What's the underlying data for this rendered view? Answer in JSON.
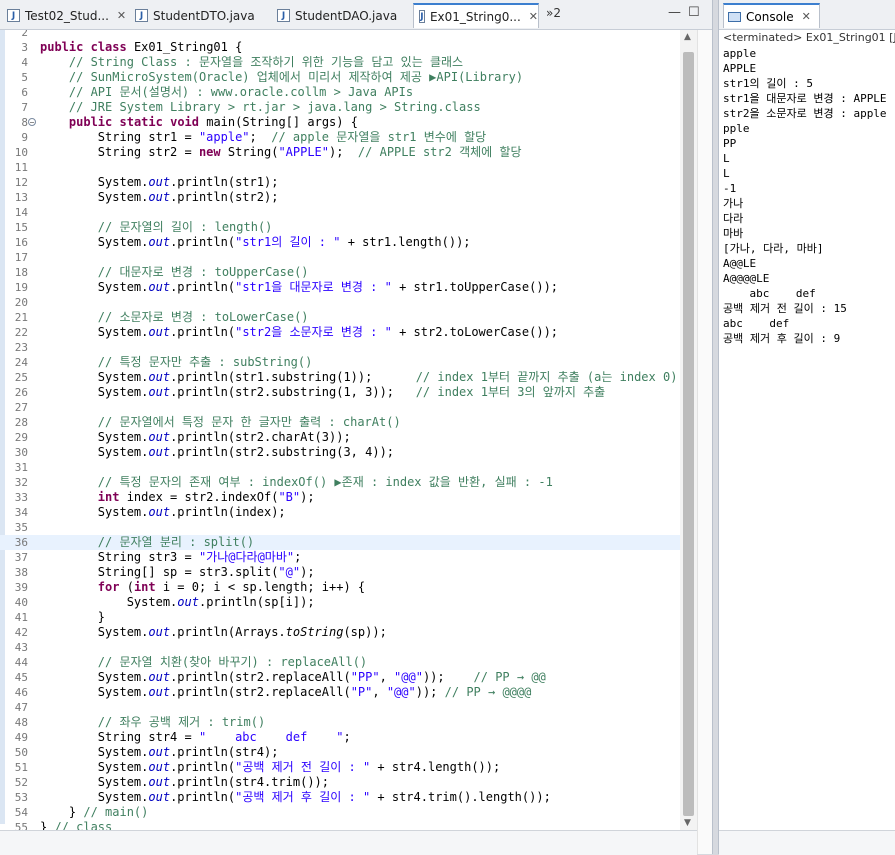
{
  "tabs": [
    {
      "label": "Test02_Stud...",
      "icon": "java-file-icon",
      "active": false
    },
    {
      "label": "StudentDTO.java",
      "icon": "java-file-icon",
      "active": false
    },
    {
      "label": "StudentDAO.java",
      "icon": "java-file-icon",
      "active": false
    },
    {
      "label": "Ex01_String0...",
      "icon": "java-file-icon",
      "active": true
    }
  ],
  "overflow_label": "»2",
  "code": [
    {
      "n": "2",
      "t": ""
    },
    {
      "n": "3",
      "t": "public class Ex01_String01 {"
    },
    {
      "n": "4",
      "t": "    // String Class : 문자열을 조작하기 위한 기능을 담고 있는 클래스"
    },
    {
      "n": "5",
      "t": "    // SunMicroSystem(Oracle) 업체에서 미리서 제작하여 제공 ▶API(Library)"
    },
    {
      "n": "6",
      "t": "    // API 문서(설명서) : www.oracle.collm > Java APIs"
    },
    {
      "n": "7",
      "t": "    // JRE System Library > rt.jar > java.lang > String.class"
    },
    {
      "n": "8",
      "t": "    public static void main(String[] args) {"
    },
    {
      "n": "9",
      "t": "        String str1 = \"apple\";  // apple 문자열을 str1 변수에 할당"
    },
    {
      "n": "10",
      "t": "        String str2 = new String(\"APPLE\");  // APPLE str2 객체에 할당"
    },
    {
      "n": "11",
      "t": ""
    },
    {
      "n": "12",
      "t": "        System.out.println(str1);"
    },
    {
      "n": "13",
      "t": "        System.out.println(str2);"
    },
    {
      "n": "14",
      "t": ""
    },
    {
      "n": "15",
      "t": "        // 문자열의 길이 : length()"
    },
    {
      "n": "16",
      "t": "        System.out.println(\"str1의 길이 : \" + str1.length());"
    },
    {
      "n": "17",
      "t": ""
    },
    {
      "n": "18",
      "t": "        // 대문자로 변경 : toUpperCase()"
    },
    {
      "n": "19",
      "t": "        System.out.println(\"str1을 대문자로 변경 : \" + str1.toUpperCase());"
    },
    {
      "n": "20",
      "t": ""
    },
    {
      "n": "21",
      "t": "        // 소문자로 변경 : toLowerCase()"
    },
    {
      "n": "22",
      "t": "        System.out.println(\"str2을 소문자로 변경 : \" + str2.toLowerCase());"
    },
    {
      "n": "23",
      "t": ""
    },
    {
      "n": "24",
      "t": "        // 특정 문자만 추출 : subString()"
    },
    {
      "n": "25",
      "t": "        System.out.println(str1.substring(1));      // index 1부터 끝까지 추출 (a는 index 0)"
    },
    {
      "n": "26",
      "t": "        System.out.println(str2.substring(1, 3));   // index 1부터 3의 앞까지 추출"
    },
    {
      "n": "27",
      "t": ""
    },
    {
      "n": "28",
      "t": "        // 문자열에서 특정 문자 한 글자만 출력 : charAt()"
    },
    {
      "n": "29",
      "t": "        System.out.println(str2.charAt(3));"
    },
    {
      "n": "30",
      "t": "        System.out.println(str2.substring(3, 4));"
    },
    {
      "n": "31",
      "t": ""
    },
    {
      "n": "32",
      "t": "        // 특정 문자의 존재 여부 : indexOf() ▶존재 : index 값을 반환, 실패 : -1"
    },
    {
      "n": "33",
      "t": "        int index = str2.indexOf(\"B\");"
    },
    {
      "n": "34",
      "t": "        System.out.println(index);"
    },
    {
      "n": "35",
      "t": ""
    },
    {
      "n": "36",
      "t": "        // 문자열 분리 : split()"
    },
    {
      "n": "37",
      "t": "        String str3 = \"가나@다라@마바\";"
    },
    {
      "n": "38",
      "t": "        String[] sp = str3.split(\"@\");"
    },
    {
      "n": "39",
      "t": "        for (int i = 0; i < sp.length; i++) {"
    },
    {
      "n": "40",
      "t": "            System.out.println(sp[i]);"
    },
    {
      "n": "41",
      "t": "        }"
    },
    {
      "n": "42",
      "t": "        System.out.println(Arrays.toString(sp));"
    },
    {
      "n": "43",
      "t": ""
    },
    {
      "n": "44",
      "t": "        // 문자열 치환(찾아 바꾸기) : replaceAll()"
    },
    {
      "n": "45",
      "t": "        System.out.println(str2.replaceAll(\"PP\", \"@@\"));    // PP → @@"
    },
    {
      "n": "46",
      "t": "        System.out.println(str2.replaceAll(\"P\", \"@@\")); // PP → @@@@"
    },
    {
      "n": "47",
      "t": ""
    },
    {
      "n": "48",
      "t": "        // 좌우 공백 제거 : trim()"
    },
    {
      "n": "49",
      "t": "        String str4 = \"    abc    def    \";"
    },
    {
      "n": "50",
      "t": "        System.out.println(str4);"
    },
    {
      "n": "51",
      "t": "        System.out.println(\"공백 제거 전 길이 : \" + str4.length());"
    },
    {
      "n": "52",
      "t": "        System.out.println(str4.trim());"
    },
    {
      "n": "53",
      "t": "        System.out.println(\"공백 제거 후 길이 : \" + str4.trim().length());"
    },
    {
      "n": "54",
      "t": "    } // main()"
    },
    {
      "n": "55",
      "t": "} // class"
    }
  ],
  "current_line": "36",
  "console": {
    "tab_label": "Console",
    "status": "<terminated> Ex01_String01 [Java",
    "lines": [
      "apple",
      "APPLE",
      "str1의 길이 : 5",
      "str1을 대문자로 변경 : APPLE",
      "str2을 소문자로 변경 : apple",
      "pple",
      "PP",
      "L",
      "L",
      "-1",
      "가나",
      "다라",
      "마바",
      "[가나, 다라, 마바]",
      "A@@LE",
      "A@@@@LE",
      "    abc    def",
      "공백 제거 전 길이 : 15",
      "abc    def",
      "공백 제거 후 길이 : 9"
    ]
  }
}
